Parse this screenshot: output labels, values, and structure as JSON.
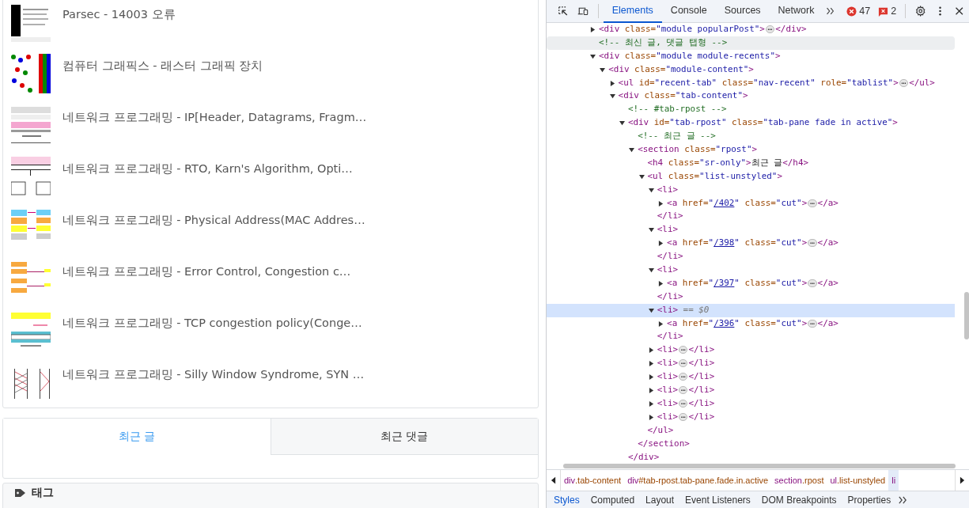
{
  "posts": [
    {
      "title": "Parsec - 14003 오류"
    },
    {
      "title": "컴퓨터 그래픽스 - 래스터 그래픽 장치"
    },
    {
      "title": "네트워크 프로그래밍 - IP[Header, Datagrams, Fragm…"
    },
    {
      "title": "네트워크 프로그래밍 - RTO, Karn's Algorithm, Opti…"
    },
    {
      "title": "네트워크 프로그래밍 - Physical Address(MAC Addres…"
    },
    {
      "title": "네트워크 프로그래밍 - Error Control, Congestion c…"
    },
    {
      "title": "네트워크 프로그래밍 - TCP congestion policy(Conge…"
    },
    {
      "title": "네트워크 프로그래밍 - Silly Window Syndrome, SYN …"
    }
  ],
  "recent_tabs": [
    {
      "label": "최근 글",
      "selected": true
    },
    {
      "label": "최근 댓글",
      "selected": false
    }
  ],
  "tags_panel": {
    "title": "태그"
  },
  "devtools": {
    "toolbar": {
      "panels": [
        {
          "label": "Elements",
          "selected": true
        },
        {
          "label": "Console",
          "selected": false
        },
        {
          "label": "Sources",
          "selected": false
        },
        {
          "label": "Network",
          "selected": false
        }
      ],
      "errors": "47",
      "issues": "2"
    },
    "dom_tree": [
      {
        "expanded": false,
        "selected": false,
        "open": [
          {
            "kind": "tag",
            "text": "<div"
          },
          {
            "kind": "attr",
            "text": " class="
          },
          {
            "kind": "value",
            "text": "\"module popularPost\""
          },
          {
            "kind": "tag",
            "text": ">"
          },
          {
            "kind": "more",
            "text": "⋯"
          },
          {
            "kind": "tag",
            "text": "</div>"
          }
        ]
      },
      {
        "selected": false,
        "hovered": true,
        "open": [
          {
            "kind": "comment",
            "text": "<!-- 최신 글, 댓글 탭형 -->"
          }
        ]
      },
      {
        "expanded": true,
        "selected": false,
        "open": [
          {
            "kind": "tag",
            "text": "<div"
          },
          {
            "kind": "attr",
            "text": " class="
          },
          {
            "kind": "value",
            "text": "\"module module-recents\""
          },
          {
            "kind": "tag",
            "text": ">"
          }
        ],
        "children": [
          {
            "expanded": true,
            "selected": false,
            "open": [
              {
                "kind": "tag",
                "text": "<div"
              },
              {
                "kind": "attr",
                "text": " class="
              },
              {
                "kind": "value",
                "text": "\"module-content\""
              },
              {
                "kind": "tag",
                "text": ">"
              }
            ],
            "children": [
              {
                "expanded": false,
                "selected": false,
                "open": [
                  {
                    "kind": "tag",
                    "text": "<ul"
                  },
                  {
                    "kind": "attr",
                    "text": " id="
                  },
                  {
                    "kind": "value",
                    "text": "\"recent-tab\""
                  },
                  {
                    "kind": "attr",
                    "text": " class="
                  },
                  {
                    "kind": "value",
                    "text": "\"nav-recent\""
                  },
                  {
                    "kind": "attr",
                    "text": " role="
                  },
                  {
                    "kind": "value",
                    "text": "\"tablist\""
                  },
                  {
                    "kind": "tag",
                    "text": ">"
                  },
                  {
                    "kind": "more",
                    "text": "⋯"
                  },
                  {
                    "kind": "tag",
                    "text": "</ul>"
                  }
                ]
              },
              {
                "expanded": true,
                "selected": false,
                "open": [
                  {
                    "kind": "tag",
                    "text": "<div"
                  },
                  {
                    "kind": "attr",
                    "text": " class="
                  },
                  {
                    "kind": "value",
                    "text": "\"tab-content\""
                  },
                  {
                    "kind": "tag",
                    "text": ">"
                  }
                ],
                "children": [
                  {
                    "selected": false,
                    "open": [
                      {
                        "kind": "comment",
                        "text": "<!-- #tab-rpost -->"
                      }
                    ]
                  },
                  {
                    "expanded": true,
                    "selected": false,
                    "open": [
                      {
                        "kind": "tag",
                        "text": "<div"
                      },
                      {
                        "kind": "attr",
                        "text": " id="
                      },
                      {
                        "kind": "value",
                        "text": "\"tab-rpost\""
                      },
                      {
                        "kind": "attr",
                        "text": " class="
                      },
                      {
                        "kind": "value",
                        "text": "\"tab-pane fade in active\""
                      },
                      {
                        "kind": "tag",
                        "text": ">"
                      }
                    ],
                    "children": [
                      {
                        "selected": false,
                        "open": [
                          {
                            "kind": "comment",
                            "text": "<!-- 최근 글 -->"
                          }
                        ]
                      },
                      {
                        "expanded": true,
                        "selected": false,
                        "open": [
                          {
                            "kind": "tag",
                            "text": "<section"
                          },
                          {
                            "kind": "attr",
                            "text": " class="
                          },
                          {
                            "kind": "value",
                            "text": "\"rpost\""
                          },
                          {
                            "kind": "tag",
                            "text": ">"
                          }
                        ],
                        "children": [
                          {
                            "selected": false,
                            "open": [
                              {
                                "kind": "tag",
                                "text": "<h4"
                              },
                              {
                                "kind": "attr",
                                "text": " class="
                              },
                              {
                                "kind": "value",
                                "text": "\"sr-only\""
                              },
                              {
                                "kind": "tag",
                                "text": ">"
                              },
                              {
                                "kind": "text",
                                "text": "최근 글"
                              },
                              {
                                "kind": "tag",
                                "text": "</h4>"
                              }
                            ]
                          },
                          {
                            "expanded": true,
                            "selected": false,
                            "open": [
                              {
                                "kind": "tag",
                                "text": "<ul"
                              },
                              {
                                "kind": "attr",
                                "text": " class="
                              },
                              {
                                "kind": "value",
                                "text": "\"list-unstyled\""
                              },
                              {
                                "kind": "tag",
                                "text": ">"
                              }
                            ],
                            "children": [
                              {
                                "expanded": true,
                                "selected": false,
                                "open": [
                                  {
                                    "kind": "tag",
                                    "text": "<li>"
                                  }
                                ],
                                "children": [
                                  {
                                    "expanded": false,
                                    "selected": false,
                                    "open": [
                                      {
                                        "kind": "tag",
                                        "text": "<a"
                                      },
                                      {
                                        "kind": "attr",
                                        "text": " href="
                                      },
                                      {
                                        "kind": "value",
                                        "text": "\""
                                      },
                                      {
                                        "kind": "link",
                                        "text": "/402"
                                      },
                                      {
                                        "kind": "value",
                                        "text": "\""
                                      },
                                      {
                                        "kind": "attr",
                                        "text": " class="
                                      },
                                      {
                                        "kind": "value",
                                        "text": "\"cut\""
                                      },
                                      {
                                        "kind": "tag",
                                        "text": ">"
                                      },
                                      {
                                        "kind": "more",
                                        "text": "⋯"
                                      },
                                      {
                                        "kind": "tag",
                                        "text": "</a>"
                                      }
                                    ]
                                  }
                                ],
                                "close": [
                                  {
                                    "kind": "tag",
                                    "text": "</li>"
                                  }
                                ]
                              },
                              {
                                "expanded": true,
                                "selected": false,
                                "open": [
                                  {
                                    "kind": "tag",
                                    "text": "<li>"
                                  }
                                ],
                                "children": [
                                  {
                                    "expanded": false,
                                    "selected": false,
                                    "open": [
                                      {
                                        "kind": "tag",
                                        "text": "<a"
                                      },
                                      {
                                        "kind": "attr",
                                        "text": " href="
                                      },
                                      {
                                        "kind": "value",
                                        "text": "\""
                                      },
                                      {
                                        "kind": "link",
                                        "text": "/398"
                                      },
                                      {
                                        "kind": "value",
                                        "text": "\""
                                      },
                                      {
                                        "kind": "attr",
                                        "text": " class="
                                      },
                                      {
                                        "kind": "value",
                                        "text": "\"cut\""
                                      },
                                      {
                                        "kind": "tag",
                                        "text": ">"
                                      },
                                      {
                                        "kind": "more",
                                        "text": "⋯"
                                      },
                                      {
                                        "kind": "tag",
                                        "text": "</a>"
                                      }
                                    ]
                                  }
                                ],
                                "close": [
                                  {
                                    "kind": "tag",
                                    "text": "</li>"
                                  }
                                ]
                              },
                              {
                                "expanded": true,
                                "selected": false,
                                "open": [
                                  {
                                    "kind": "tag",
                                    "text": "<li>"
                                  }
                                ],
                                "children": [
                                  {
                                    "expanded": false,
                                    "selected": false,
                                    "open": [
                                      {
                                        "kind": "tag",
                                        "text": "<a"
                                      },
                                      {
                                        "kind": "attr",
                                        "text": " href="
                                      },
                                      {
                                        "kind": "value",
                                        "text": "\""
                                      },
                                      {
                                        "kind": "link",
                                        "text": "/397"
                                      },
                                      {
                                        "kind": "value",
                                        "text": "\""
                                      },
                                      {
                                        "kind": "attr",
                                        "text": " class="
                                      },
                                      {
                                        "kind": "value",
                                        "text": "\"cut\""
                                      },
                                      {
                                        "kind": "tag",
                                        "text": ">"
                                      },
                                      {
                                        "kind": "more",
                                        "text": "⋯"
                                      },
                                      {
                                        "kind": "tag",
                                        "text": "</a>"
                                      }
                                    ]
                                  }
                                ],
                                "close": [
                                  {
                                    "kind": "tag",
                                    "text": "</li>"
                                  }
                                ]
                              },
                              {
                                "expanded": true,
                                "selected": true,
                                "open": [
                                  {
                                    "kind": "tag",
                                    "text": "<li>"
                                  },
                                  {
                                    "kind": "hint",
                                    "text": " == $0"
                                  }
                                ],
                                "children": [
                                  {
                                    "expanded": false,
                                    "selected": false,
                                    "open": [
                                      {
                                        "kind": "tag",
                                        "text": "<a"
                                      },
                                      {
                                        "kind": "attr",
                                        "text": " href="
                                      },
                                      {
                                        "kind": "value",
                                        "text": "\""
                                      },
                                      {
                                        "kind": "link",
                                        "text": "/396"
                                      },
                                      {
                                        "kind": "value",
                                        "text": "\""
                                      },
                                      {
                                        "kind": "attr",
                                        "text": " class="
                                      },
                                      {
                                        "kind": "value",
                                        "text": "\"cut\""
                                      },
                                      {
                                        "kind": "tag",
                                        "text": ">"
                                      },
                                      {
                                        "kind": "more",
                                        "text": "⋯"
                                      },
                                      {
                                        "kind": "tag",
                                        "text": "</a>"
                                      }
                                    ]
                                  }
                                ],
                                "close": [
                                  {
                                    "kind": "tag",
                                    "text": "</li>"
                                  }
                                ]
                              },
                              {
                                "expanded": false,
                                "selected": false,
                                "open": [
                                  {
                                    "kind": "tag",
                                    "text": "<li>"
                                  },
                                  {
                                    "kind": "more",
                                    "text": "⋯"
                                  },
                                  {
                                    "kind": "tag",
                                    "text": "</li>"
                                  }
                                ]
                              },
                              {
                                "expanded": false,
                                "selected": false,
                                "open": [
                                  {
                                    "kind": "tag",
                                    "text": "<li>"
                                  },
                                  {
                                    "kind": "more",
                                    "text": "⋯"
                                  },
                                  {
                                    "kind": "tag",
                                    "text": "</li>"
                                  }
                                ]
                              },
                              {
                                "expanded": false,
                                "selected": false,
                                "open": [
                                  {
                                    "kind": "tag",
                                    "text": "<li>"
                                  },
                                  {
                                    "kind": "more",
                                    "text": "⋯"
                                  },
                                  {
                                    "kind": "tag",
                                    "text": "</li>"
                                  }
                                ]
                              },
                              {
                                "expanded": false,
                                "selected": false,
                                "open": [
                                  {
                                    "kind": "tag",
                                    "text": "<li>"
                                  },
                                  {
                                    "kind": "more",
                                    "text": "⋯"
                                  },
                                  {
                                    "kind": "tag",
                                    "text": "</li>"
                                  }
                                ]
                              },
                              {
                                "expanded": false,
                                "selected": false,
                                "open": [
                                  {
                                    "kind": "tag",
                                    "text": "<li>"
                                  },
                                  {
                                    "kind": "more",
                                    "text": "⋯"
                                  },
                                  {
                                    "kind": "tag",
                                    "text": "</li>"
                                  }
                                ]
                              },
                              {
                                "expanded": false,
                                "selected": false,
                                "open": [
                                  {
                                    "kind": "tag",
                                    "text": "<li>"
                                  },
                                  {
                                    "kind": "more",
                                    "text": "⋯"
                                  },
                                  {
                                    "kind": "tag",
                                    "text": "</li>"
                                  }
                                ]
                              }
                            ],
                            "close": [
                              {
                                "kind": "tag",
                                "text": "</ul>"
                              }
                            ]
                          }
                        ],
                        "close": [
                          {
                            "kind": "tag",
                            "text": "</section>"
                          }
                        ]
                      }
                    ],
                    "close": [
                      {
                        "kind": "tag",
                        "text": "</div>"
                      }
                    ]
                  }
                ]
              }
            ]
          }
        ]
      }
    ],
    "breadcrumbs": [
      {
        "tag": "div",
        "rest": ".tab-content",
        "selected": false
      },
      {
        "tag": "div",
        "rest": "#tab-rpost.tab-pane.fade.in.active",
        "selected": false
      },
      {
        "tag": "section",
        "rest": ".rpost",
        "selected": false
      },
      {
        "tag": "ul",
        "rest": ".list-unstyled",
        "selected": false
      },
      {
        "tag": "li",
        "selected": true
      }
    ],
    "bottom_tabs": [
      {
        "label": "Styles",
        "selected": true
      },
      {
        "label": "Computed",
        "selected": false
      },
      {
        "label": "Layout",
        "selected": false
      },
      {
        "label": "Event Listeners",
        "selected": false
      },
      {
        "label": "DOM Breakpoints",
        "selected": false
      },
      {
        "label": "Properties",
        "selected": false
      }
    ]
  }
}
